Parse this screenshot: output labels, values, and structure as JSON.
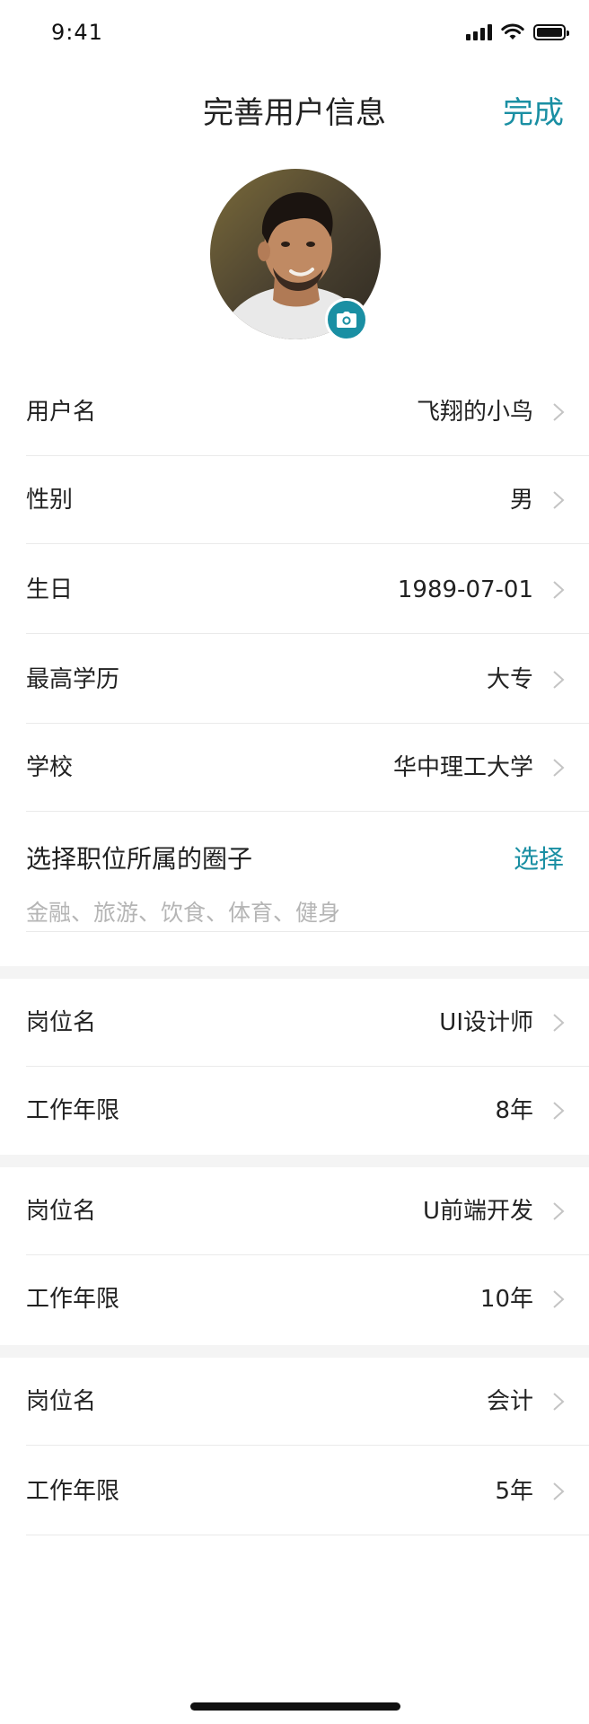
{
  "status_bar": {
    "time": "9:41"
  },
  "nav": {
    "title": "完善用户信息",
    "done_label": "完成"
  },
  "avatar": {
    "alt": "用户头像"
  },
  "profile_rows": [
    {
      "label": "用户名",
      "value": "飞翔的小鸟"
    },
    {
      "label": "性别",
      "value": "男"
    },
    {
      "label": "生日",
      "value": "1989-07-01"
    },
    {
      "label": "最高学历",
      "value": "大专"
    },
    {
      "label": "学校",
      "value": "华中理工大学"
    }
  ],
  "circle": {
    "title": "选择职位所属的圈子",
    "select_label": "选择",
    "hint": "金融、旅游、饮食、体育、健身"
  },
  "jobs": [
    {
      "position_label": "岗位名",
      "position_value": "UI设计师",
      "years_label": "工作年限",
      "years_value": "8年"
    },
    {
      "position_label": "岗位名",
      "position_value": "U前端开发",
      "years_label": "工作年限",
      "years_value": "10年"
    },
    {
      "position_label": "岗位名",
      "position_value": "会计",
      "years_label": "工作年限",
      "years_value": "5年"
    }
  ],
  "colors": {
    "accent": "#1a8fa3",
    "text": "#222222",
    "hint": "#b5b5b5",
    "divider": "#eaeaea",
    "section_gap": "#f4f4f4"
  }
}
